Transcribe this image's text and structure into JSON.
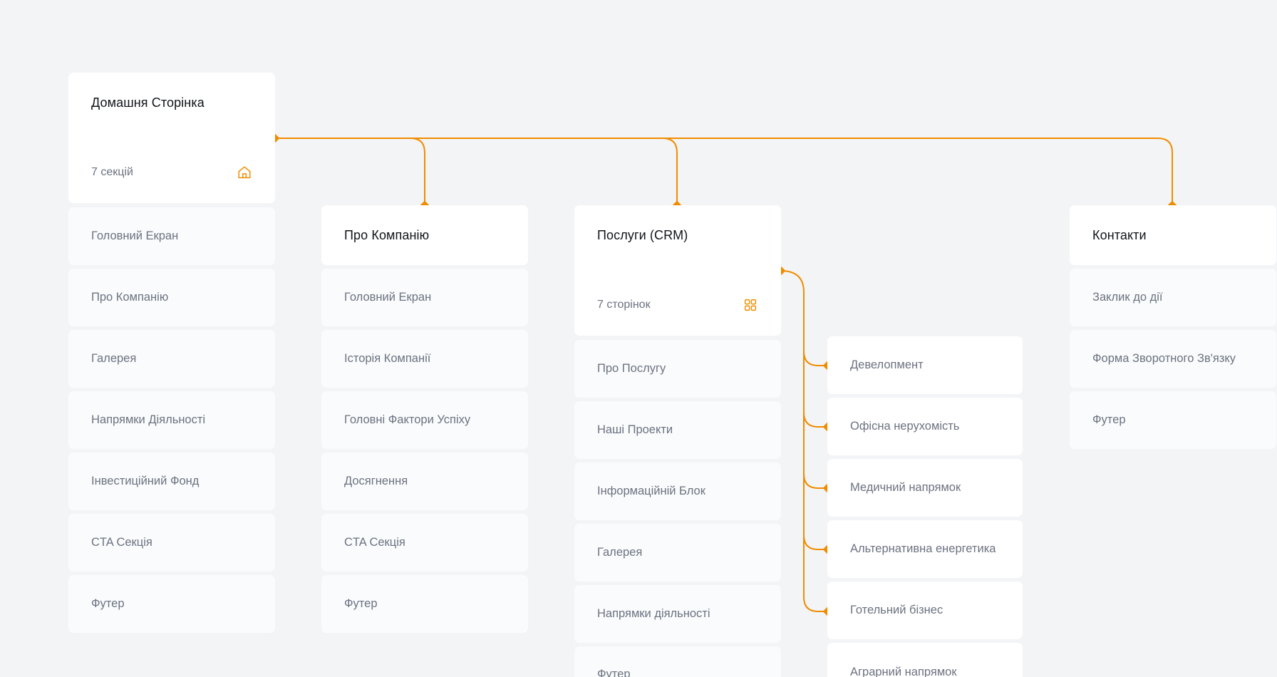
{
  "accent_color": "#f08c00",
  "columns": [
    {
      "title": "Домашня Сторінка",
      "count": "7 секцій",
      "icon": "home-icon",
      "items": [
        "Головний Екран",
        "Про Компанію",
        "Галерея",
        "Напрямки Діяльності",
        "Інвестиційний Фонд",
        "CTA Секція",
        "Футер"
      ]
    },
    {
      "title": "Про Компанію",
      "items": [
        "Головний Екран",
        "Історія Компанії",
        "Головні Фактори Успіху",
        "Досягнення",
        "CTA Секція",
        "Футер"
      ]
    },
    {
      "title": "Послуги (CRM)",
      "count": "7 сторінок",
      "icon": "grid-icon",
      "items": [
        "Про Послугу",
        "Наші Проекти",
        "Інформаційній Блок",
        "Галерея",
        "Напрямки діяльності",
        "Футер"
      ]
    },
    {
      "title": "Контакти",
      "items": [
        "Заклик до дії",
        "Форма Зворотного Зв'язку",
        "Футер"
      ]
    }
  ],
  "service_pages": [
    "Девелопмент",
    "Офісна нерухомість",
    "Медичний напрямок",
    "Альтернативна енергетика",
    "Готельний бізнес",
    "Аграрний напрямок"
  ]
}
